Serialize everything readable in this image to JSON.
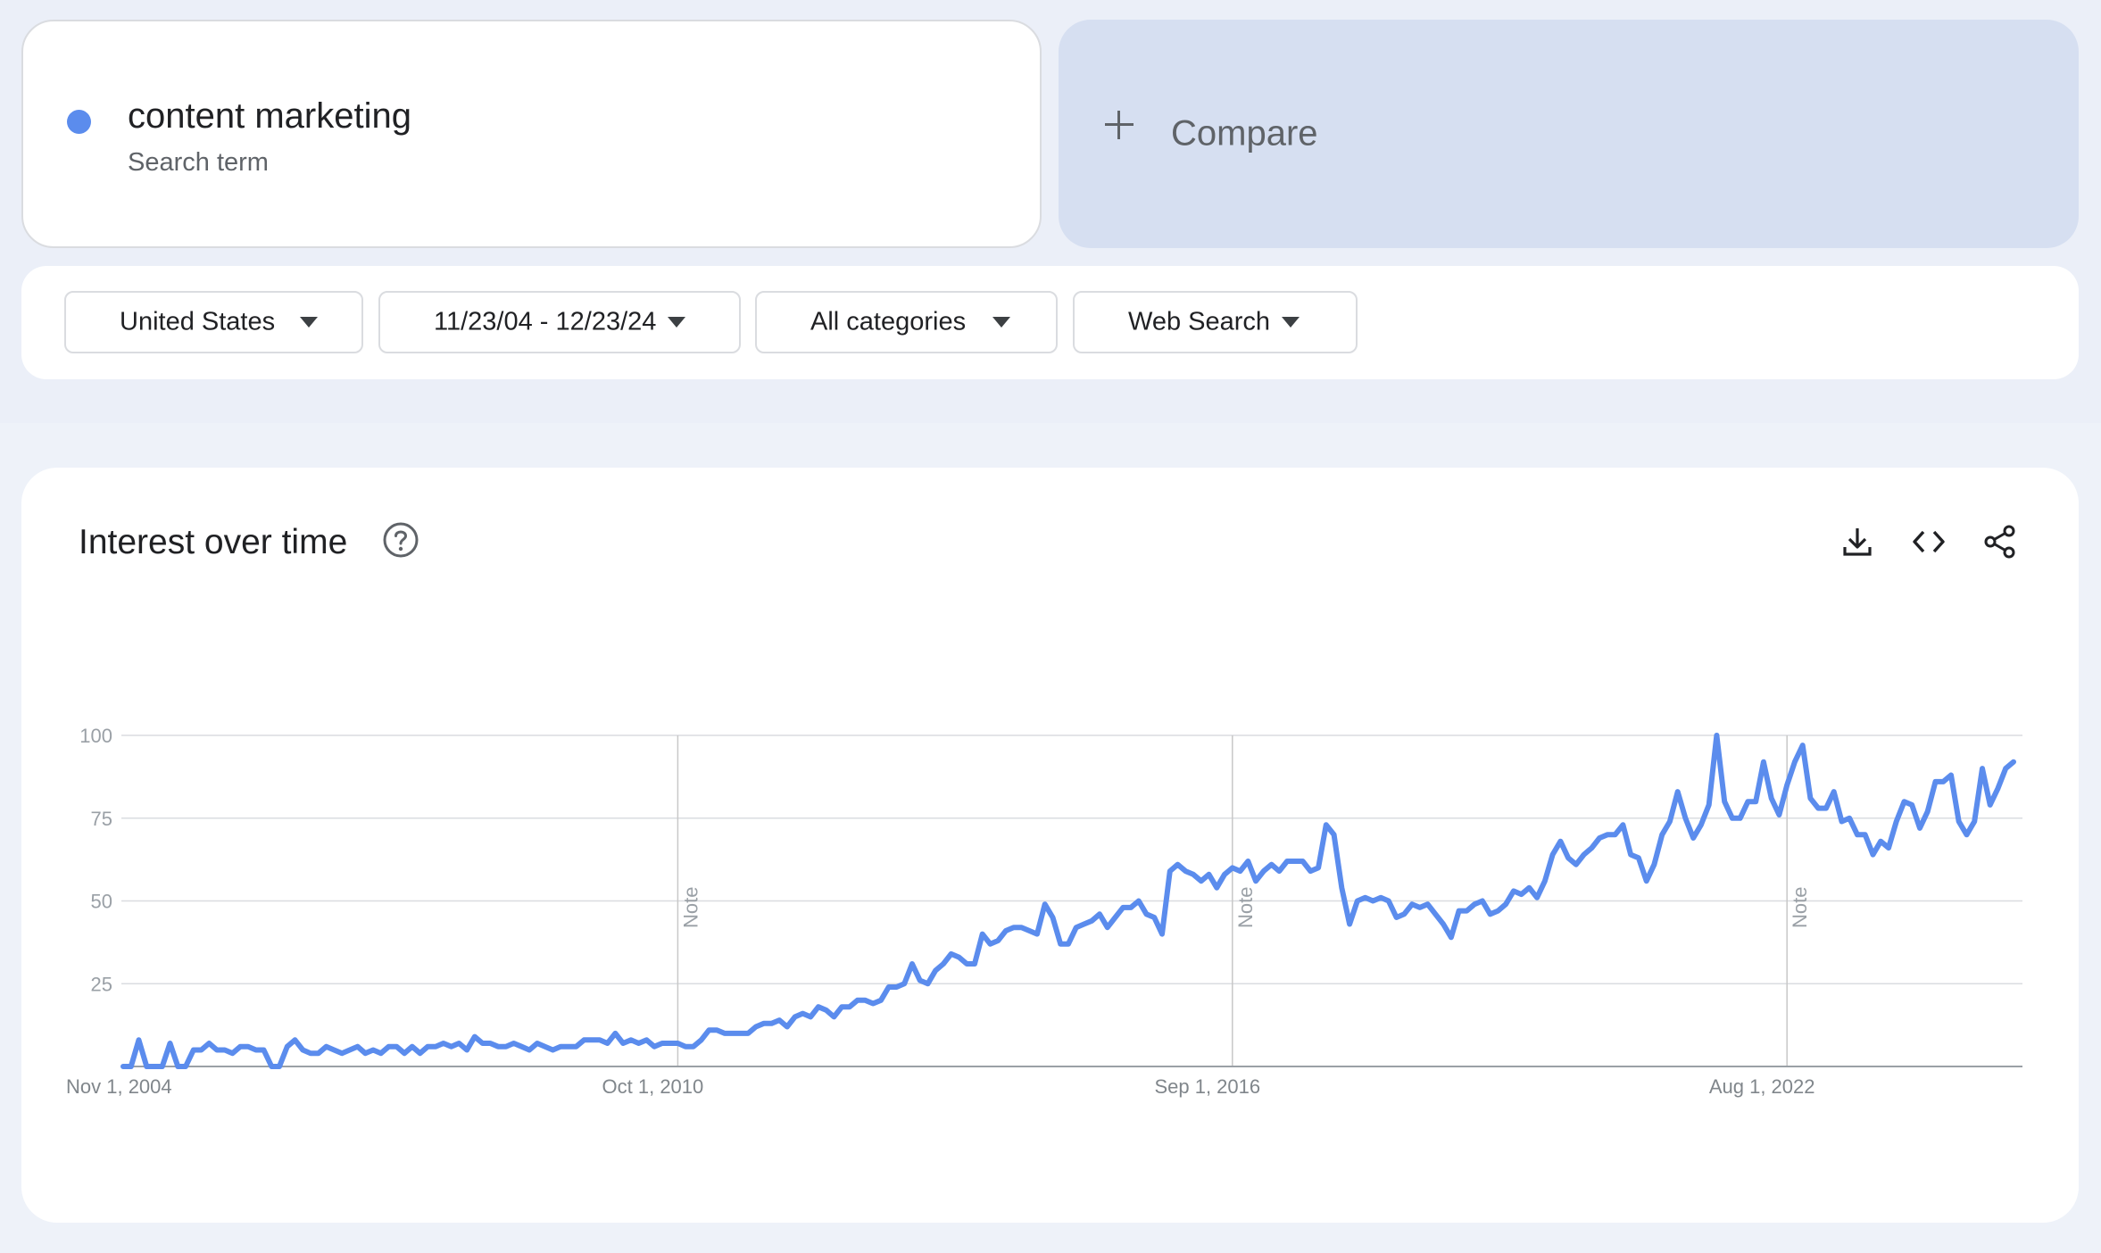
{
  "search_term": {
    "name": "content marketing",
    "subtitle": "Search term",
    "color": "#5b8ced"
  },
  "compare": {
    "label": "Compare"
  },
  "filters": {
    "region": "United States",
    "date_range": "11/23/04 - 12/23/24",
    "category": "All categories",
    "property": "Web Search"
  },
  "panel": {
    "title": "Interest over time",
    "icons": [
      "help-icon",
      "download-icon",
      "embed-icon",
      "share-icon"
    ]
  },
  "chart_data": {
    "type": "line",
    "x_tick_labels": [
      "Nov 1, 2004",
      "Oct 1, 2010",
      "Sep 1, 2016",
      "Aug 1, 2022"
    ],
    "y_ticks": [
      25,
      50,
      75,
      100
    ],
    "ylim": [
      0,
      100
    ],
    "grid": true,
    "note_label": "Note",
    "series": [
      {
        "color": "#5b8ced",
        "values": [
          0,
          0,
          8,
          0,
          0,
          0,
          7,
          0,
          0,
          5,
          5,
          7,
          5,
          5,
          4,
          6,
          6,
          5,
          5,
          0,
          0,
          6,
          8,
          5,
          4,
          4,
          6,
          5,
          4,
          5,
          6,
          4,
          5,
          4,
          6,
          6,
          4,
          6,
          4,
          6,
          6,
          7,
          6,
          7,
          5,
          9,
          7,
          7,
          6,
          6,
          7,
          6,
          5,
          7,
          6,
          5,
          6,
          6,
          6,
          8,
          8,
          8,
          7,
          10,
          7,
          8,
          7,
          8,
          6,
          7,
          7,
          7,
          6,
          6,
          8,
          11,
          11,
          10,
          10,
          10,
          10,
          12,
          13,
          13,
          14,
          12,
          15,
          16,
          15,
          18,
          17,
          15,
          18,
          18,
          20,
          20,
          19,
          20,
          24,
          24,
          25,
          31,
          26,
          25,
          29,
          31,
          34,
          33,
          31,
          31,
          40,
          37,
          38,
          41,
          42,
          42,
          41,
          40,
          49,
          45,
          37,
          37,
          42,
          43,
          44,
          46,
          42,
          45,
          48,
          48,
          50,
          46,
          45,
          40,
          59,
          61,
          59,
          58,
          56,
          58,
          54,
          58,
          60,
          59,
          62,
          56,
          59,
          61,
          59,
          62,
          62,
          62,
          59,
          60,
          73,
          70,
          54,
          43,
          50,
          51,
          50,
          51,
          50,
          45,
          46,
          49,
          48,
          49,
          46,
          43,
          39,
          47,
          47,
          49,
          50,
          46,
          47,
          49,
          53,
          52,
          54,
          51,
          56,
          64,
          68,
          63,
          61,
          64,
          66,
          69,
          70,
          70,
          73,
          64,
          63,
          56,
          61,
          70,
          74,
          83,
          75,
          69,
          73,
          79,
          100,
          80,
          75,
          75,
          80,
          80,
          92,
          81,
          76,
          85,
          92,
          97,
          81,
          78,
          78,
          83,
          74,
          75,
          70,
          70,
          64,
          68,
          66,
          74,
          80,
          79,
          72,
          77,
          86,
          86,
          88,
          74,
          70,
          74,
          90,
          79,
          84,
          90,
          92
        ]
      }
    ],
    "notes_at_tick": [
      "Oct 1, 2010",
      "Sep 1, 2016",
      "Aug 1, 2022"
    ]
  }
}
